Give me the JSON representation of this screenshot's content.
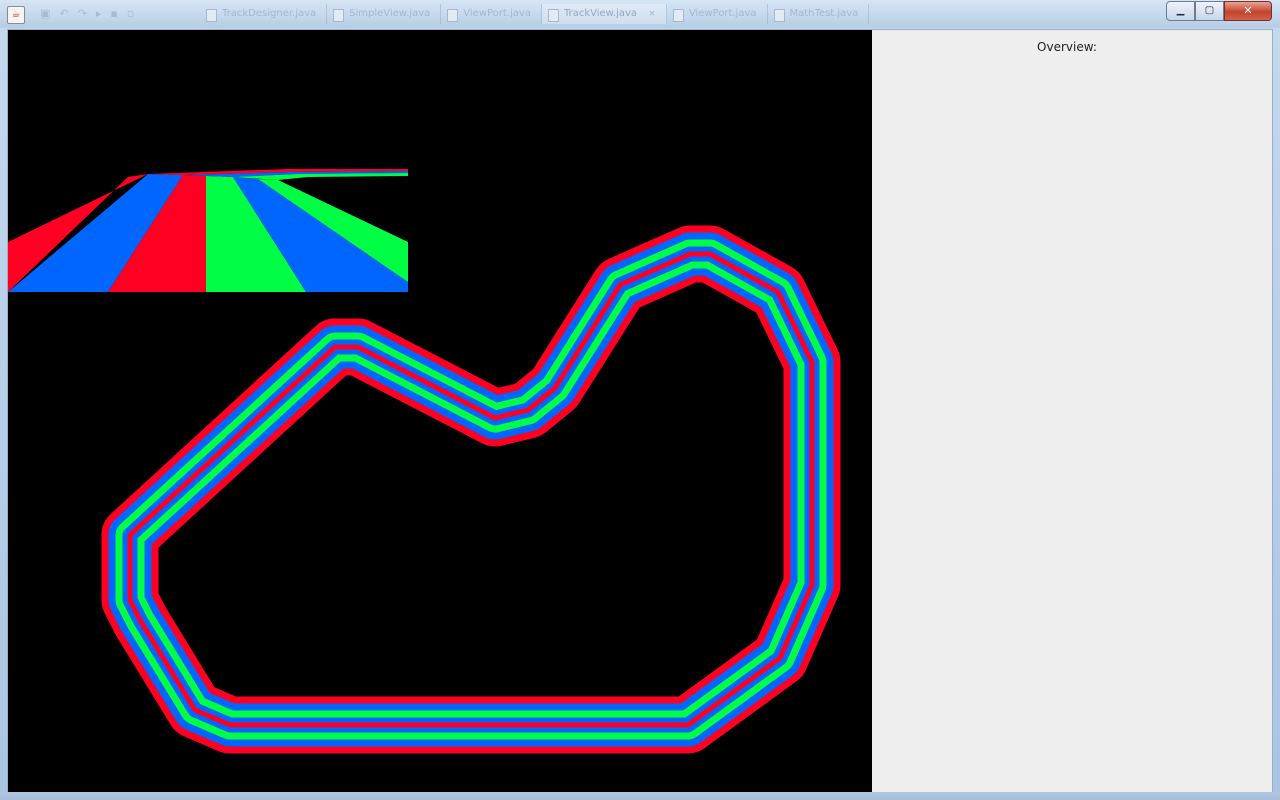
{
  "window": {
    "app_icon_glyph": "☕",
    "quick_access_icons": [
      "save-icon",
      "undo-icon",
      "redo-icon",
      "run-icon",
      "debug-icon",
      "build-icon"
    ],
    "quick_access_glyphs": [
      "▣",
      "↶",
      "↷",
      "▸",
      "▪",
      "▫"
    ],
    "tabs": [
      {
        "label": "TrackDesigner.java",
        "active": false
      },
      {
        "label": "SimpleView.java",
        "active": false
      },
      {
        "label": "ViewPort.java",
        "active": false
      },
      {
        "label": "TrackView.java",
        "active": true
      },
      {
        "label": "ViewPort.java",
        "active": false
      },
      {
        "label": "MathTest.java",
        "active": false
      }
    ],
    "close_tab_glyph": "×",
    "controls": {
      "minimize": "▁",
      "maximize": "▢",
      "close": "✕"
    }
  },
  "overview_panel": {
    "label": "Overview:"
  },
  "colors": {
    "canvas_background": "#000000",
    "track_red": "#ff0022",
    "track_blue": "#0066ff",
    "track_green": "#00ff44",
    "panel_background": "#eeeeee"
  }
}
